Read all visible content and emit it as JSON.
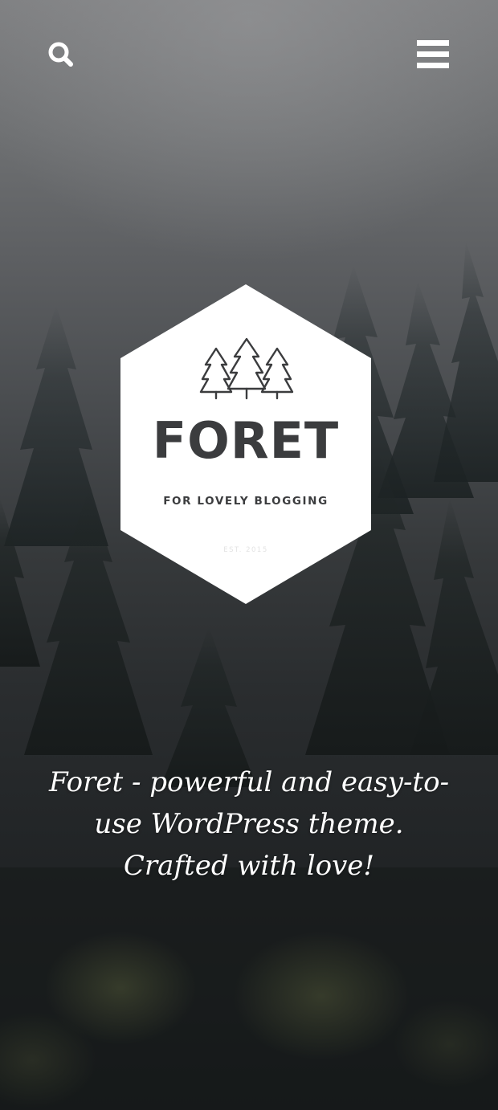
{
  "header": {
    "search_icon": "search-icon",
    "menu_icon": "hamburger-menu-icon"
  },
  "logo": {
    "icon": "three-trees-icon",
    "title": "FORET",
    "tagline": "FOR LOVELY BLOGGING",
    "est": "EST. 2015"
  },
  "hero": {
    "description": "Foret - powerful and easy-to-use WordPress theme. Crafted with love!"
  },
  "colors": {
    "logo_background": "#ffffff",
    "logo_text": "#3b3c3e",
    "hero_text": "#ffffff",
    "icon_color": "#ffffff"
  }
}
